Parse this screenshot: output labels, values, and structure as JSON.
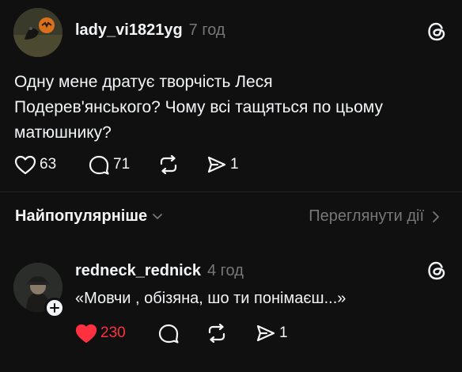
{
  "post": {
    "username": "lady_vi1821yg",
    "time": "7 год",
    "text_line1": "Одну мене дратує творчість Леся",
    "text_line2": "Подерев'янського? Чому всі тащяться по цьому",
    "text_line3": "матюшнику?",
    "likes": "63",
    "comments": "71",
    "shares": "1"
  },
  "sort": {
    "label": "Найпопулярніше",
    "view_activity": "Переглянути дії"
  },
  "reply": {
    "username": "redneck_rednick",
    "time": "4 год",
    "text": "«Мовчи , обізяна, шо ти понімаєш...»",
    "likes": "230",
    "shares": "1",
    "liked_color": "#ff3040"
  },
  "colors": {
    "background": "#101010",
    "text": "#f3f5f7",
    "muted": "#777777",
    "like_active": "#ff3040"
  },
  "icons": [
    "threads-logo-icon",
    "heart-icon",
    "comment-icon",
    "repost-icon",
    "share-icon",
    "chevron-down-icon",
    "chevron-right-icon",
    "plus-icon"
  ]
}
